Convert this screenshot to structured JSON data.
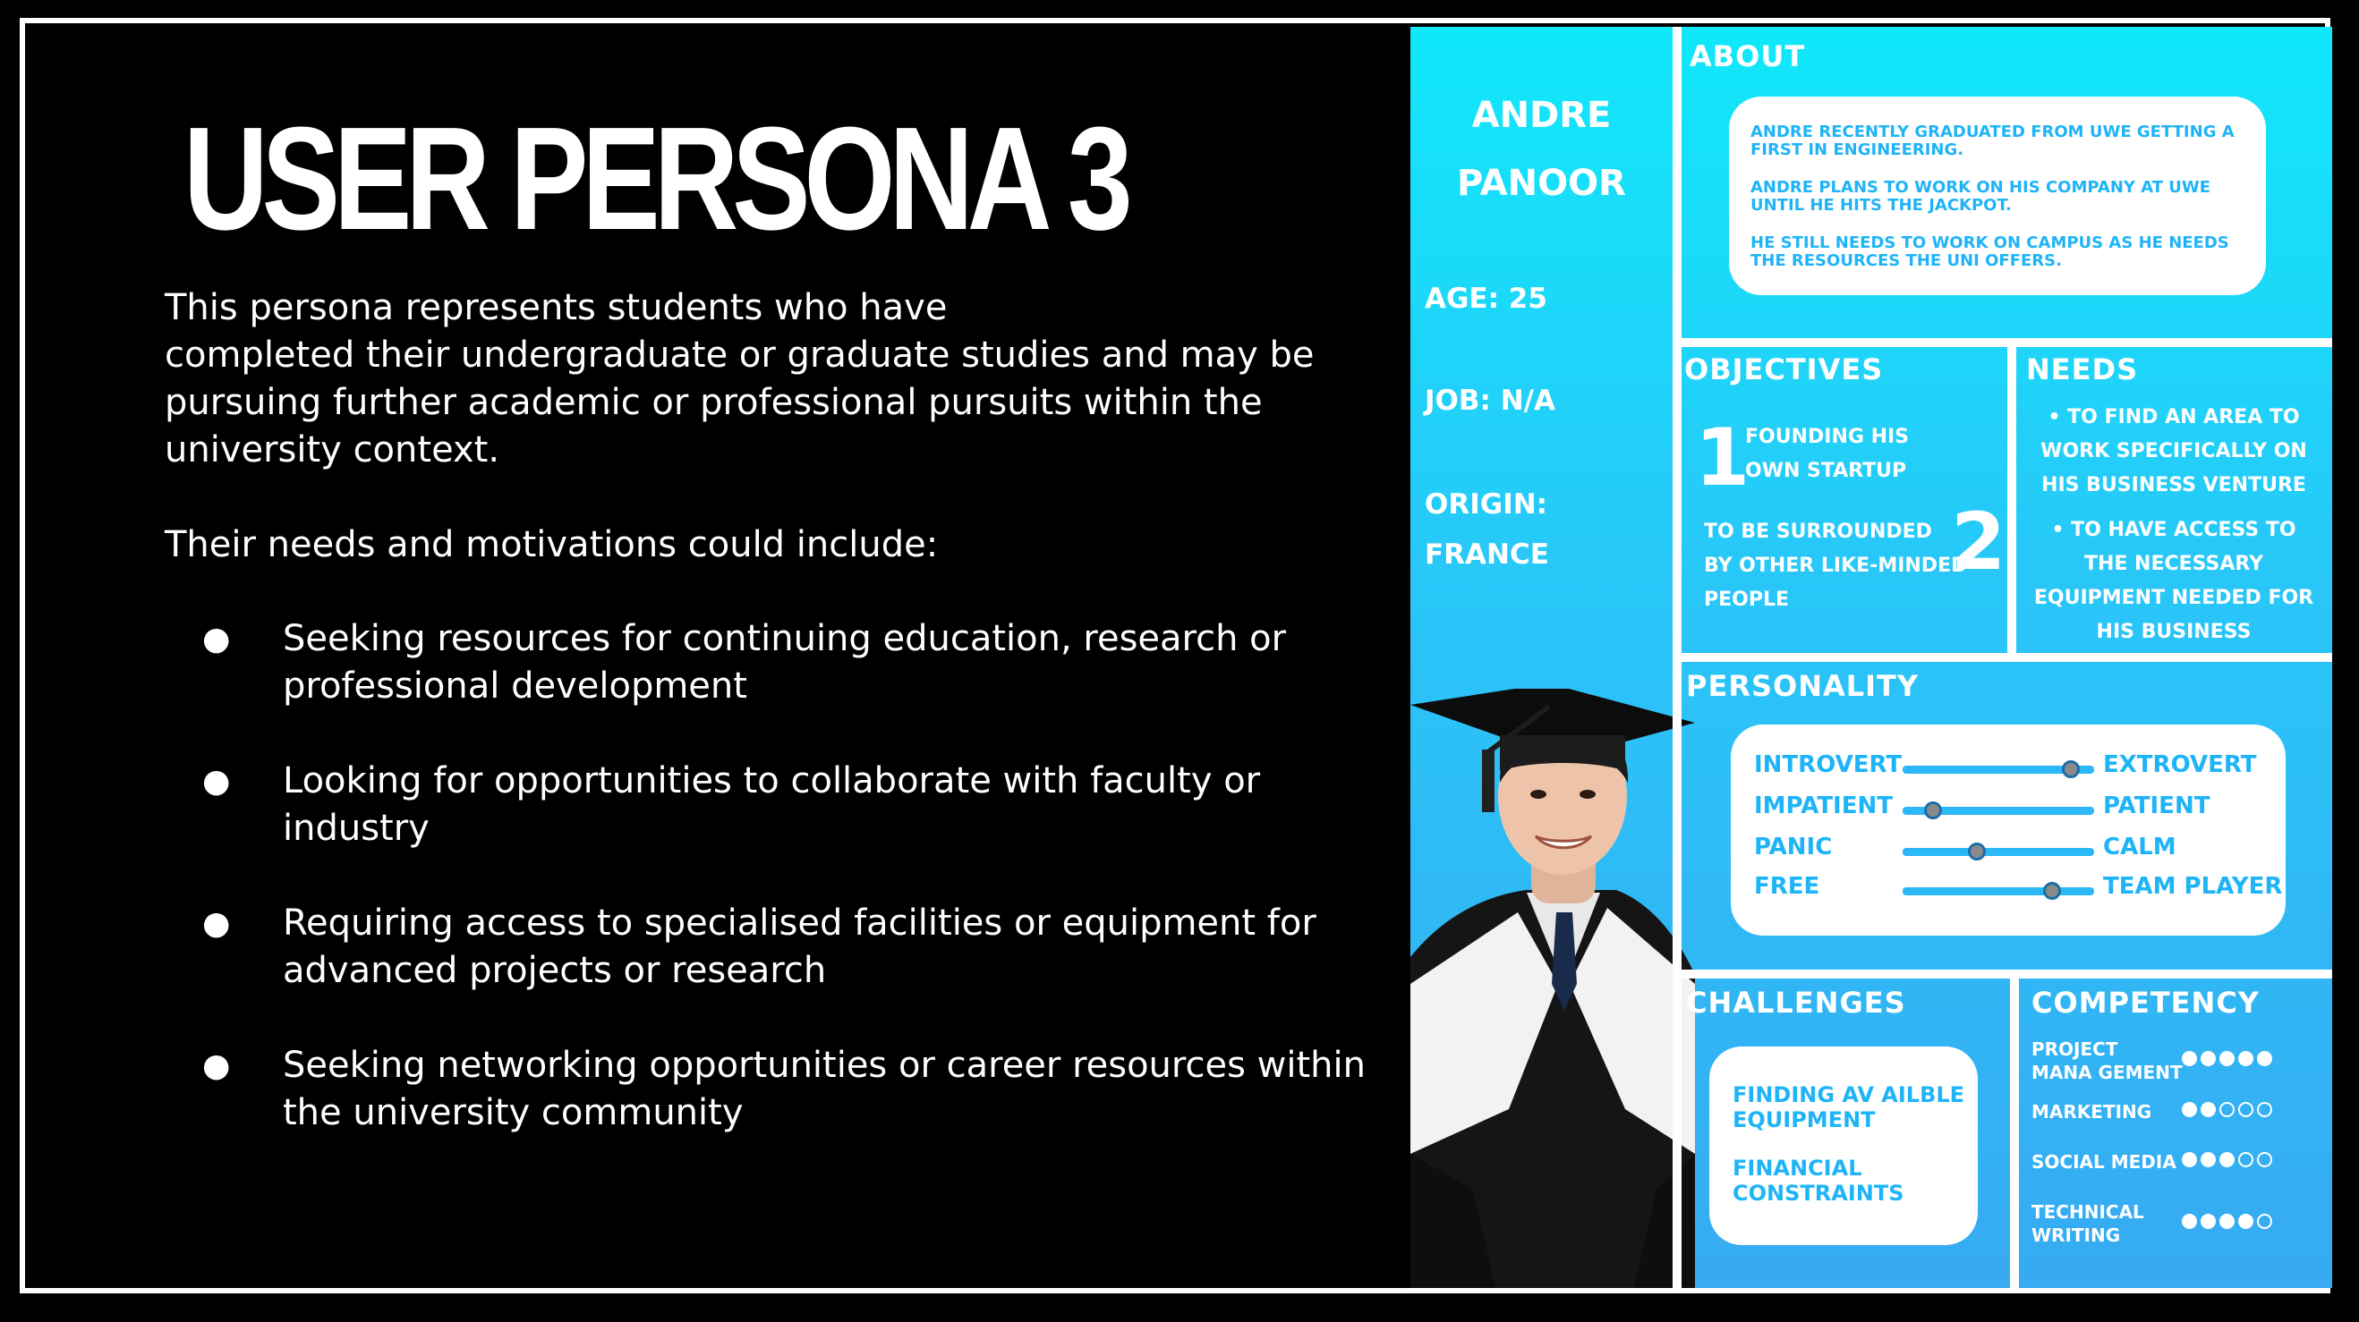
{
  "slide": {
    "title": "USER PERSONA 3",
    "intro_line1": "This persona represents students who have",
    "intro_line2": "completed their undergraduate or graduate studies and may be pursuing further academic or professional pursuits within the university context.",
    "needs_heading": "Their needs and motivations could include:",
    "bullets": [
      "Seeking resources for continuing education, research or professional development",
      "Looking for opportunities to collaborate with faculty or industry",
      "Requiring access to specialised facilities or equipment for advanced projects or research",
      "Seeking networking opportunities or career resources within the university community"
    ],
    "bullet_glyph": "●"
  },
  "persona": {
    "first_name": "ANDRE",
    "last_name": "PANOOR",
    "age": "AGE: 25",
    "job": "JOB: N/A",
    "origin_label": "ORIGIN:",
    "origin_value": "FRANCE",
    "about": {
      "title": "ABOUT",
      "paragraphs": [
        "ANDRE RECENTLY GRADUATED FROM UWE GETTING A FIRST IN ENGINEERING.",
        "ANDRE PLANS TO WORK ON HIS COMPANY AT UWE UNTIL HE HITS THE JACKPOT.",
        "HE STILL NEEDS TO WORK ON CAMPUS AS HE NEEDS THE RESOURCES THE UNI OFFERS."
      ]
    },
    "objectives": {
      "title": "OBJECTIVES",
      "items": [
        {
          "num": "1",
          "line1": "FOUNDING HIS",
          "line2": "OWN STARTUP"
        },
        {
          "num": "2",
          "line1": "TO BE SURROUNDED",
          "line2": "BY OTHER LIKE-MINDED",
          "line3": "PEOPLE"
        }
      ]
    },
    "needs": {
      "title": "NEEDS",
      "items": [
        {
          "l1": "• TO FIND AN AREA TO",
          "l2": "WORK SPECIFICALLY ON",
          "l3": "HIS BUSINESS VENTURE"
        },
        {
          "l1": "• TO HAVE ACCESS TO",
          "l2": "THE NECESSARY",
          "l3": "EQUIPMENT NEEDED FOR",
          "l4": "HIS BUSINESS"
        }
      ]
    },
    "personality": {
      "title": "PERSONALITY",
      "traits": [
        {
          "left": "INTROVERT",
          "right": "EXTROVERT",
          "value": 0.88
        },
        {
          "left": "IMPATIENT",
          "right": "PATIENT",
          "value": 0.16
        },
        {
          "left": "PANIC",
          "right": "CALM",
          "value": 0.39
        },
        {
          "left": "FREE",
          "right": "TEAM PLAYER",
          "value": 0.78
        }
      ]
    },
    "challenges": {
      "title": "CHALLENGES",
      "items": [
        "FINDING AV AILBLE EQUIPMENT",
        "FINANCIAL CONSTRAINTS"
      ]
    },
    "competency": {
      "title": "COMPETENCY",
      "items": [
        {
          "label": "PROJECT MANA GEMENT",
          "level": 5,
          "max": 5
        },
        {
          "label": "MARKETING",
          "level": 2,
          "max": 5
        },
        {
          "label": "SOCIAL MEDIA",
          "level": 3,
          "max": 5
        },
        {
          "label": "TECHNICAL WRITING",
          "level": 4,
          "max": 5
        }
      ]
    },
    "colors": {
      "panel_top": "#10e8fa",
      "panel_bottom": "#37aaf2",
      "accent_text": "#1fb4f7",
      "gown": "#111111"
    },
    "photo_icon": "graduate-photo"
  }
}
